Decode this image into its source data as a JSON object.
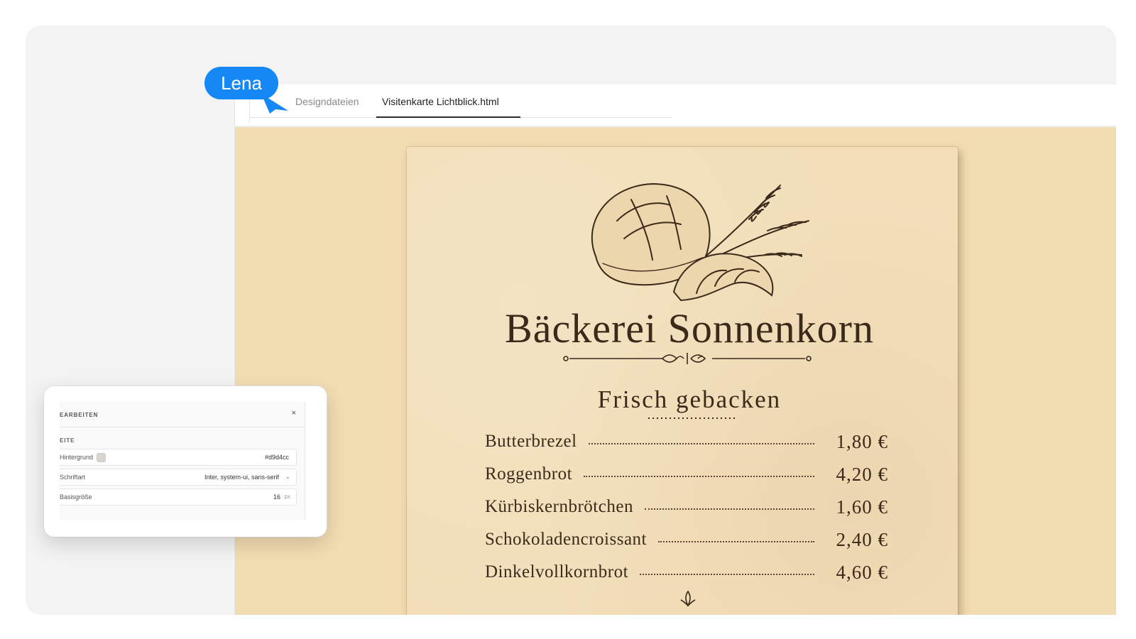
{
  "tabs": [
    {
      "label": "Designdateien",
      "active": false
    },
    {
      "label": "Visitenkarte Lichtblick.html",
      "active": true
    }
  ],
  "collaborator": {
    "name": "Lena",
    "color": "#1688f5"
  },
  "document": {
    "background_color": "#f2dcb2",
    "paper_color": "#f2dfba",
    "title": "Bäckerei Sonnenkorn",
    "subtitle": "Frisch gebacken",
    "menu": [
      {
        "name": "Butterbrezel",
        "price": "1,80 €"
      },
      {
        "name": "Roggenbrot",
        "price": "4,20 €"
      },
      {
        "name": "Kürbiskernbrötchen",
        "price": "1,60 €"
      },
      {
        "name": "Schokoladencroissant",
        "price": "2,40 €"
      },
      {
        "name": "Dinkelvollkornbrot",
        "price": "4,60 €"
      }
    ]
  },
  "panel": {
    "title": "EARBEITEN",
    "close": "×",
    "section": "EITE",
    "rows": {
      "background": {
        "label": "Hintergrund",
        "value": "#d9d4cc"
      },
      "font": {
        "label": "Schriftart",
        "value": "Inter, system-ui, sans-serif"
      },
      "base_size": {
        "label": "Basisgröße",
        "value": "16",
        "unit": "px"
      }
    }
  }
}
